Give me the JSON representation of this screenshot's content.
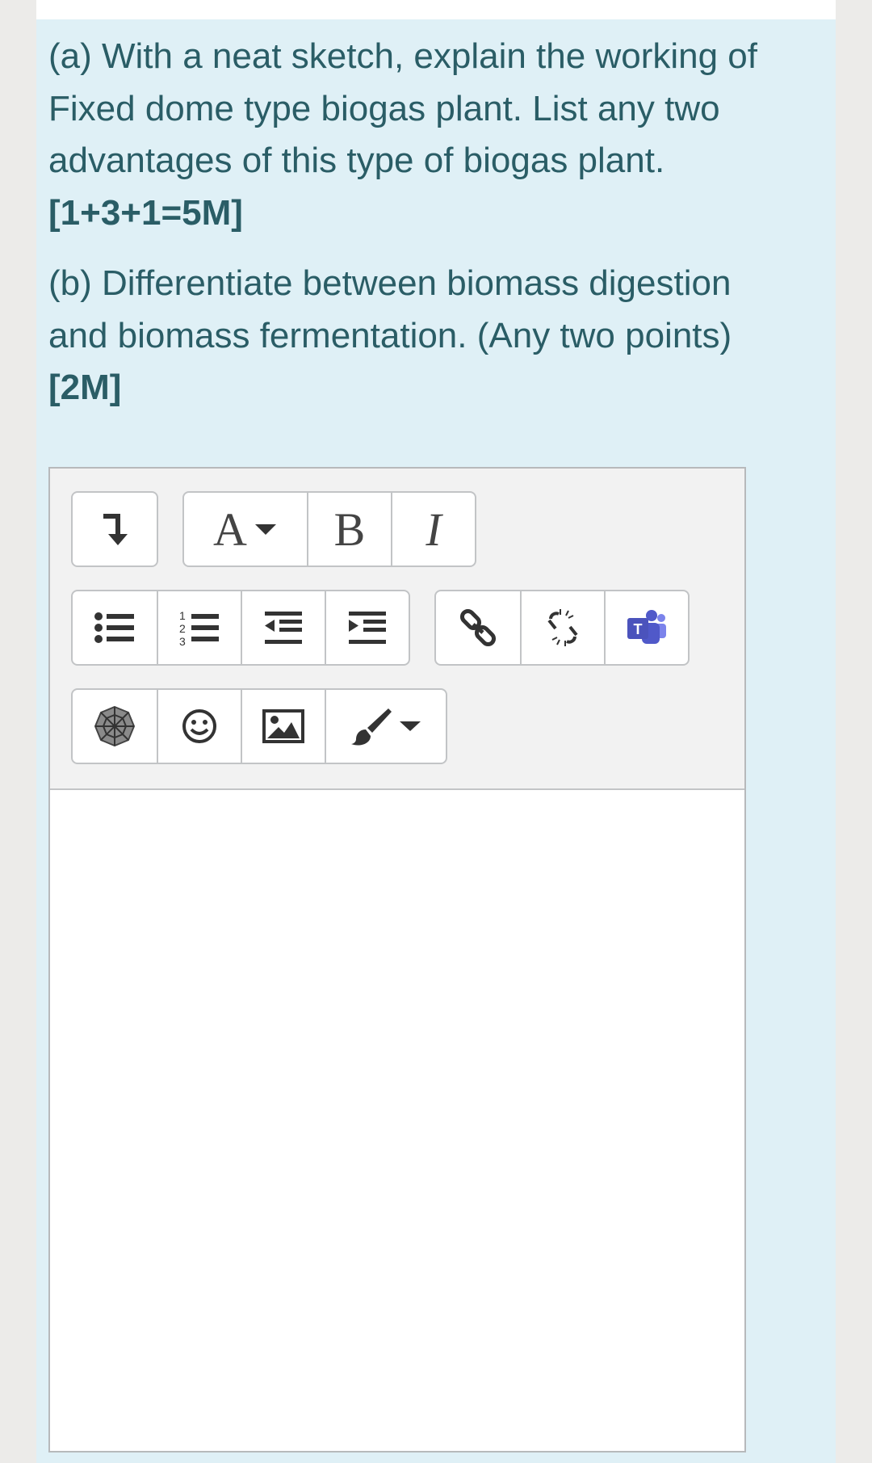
{
  "question_a": {
    "text": "(a) With a neat sketch, explain the working of Fixed dome type biogas plant. List any two advantages of this type of biogas plant.",
    "marks": "[1+3+1=5M]"
  },
  "question_b": {
    "text": "(b) Differentiate between biomass digestion and biomass fermentation. (Any two points)",
    "marks": "[2M]"
  },
  "toolbar": {
    "font_label": "A",
    "bold_label": "B",
    "italic_label": "I",
    "icons": [
      "show-more-icon",
      "font-color-icon",
      "bold-icon",
      "italic-icon",
      "unordered-list-icon",
      "ordered-list-icon",
      "outdent-icon",
      "indent-icon",
      "link-icon",
      "unlink-icon",
      "teams-icon",
      "equation-icon",
      "emoji-icon",
      "image-icon",
      "brush-dropdown-icon"
    ]
  },
  "editor": {
    "content": ""
  }
}
